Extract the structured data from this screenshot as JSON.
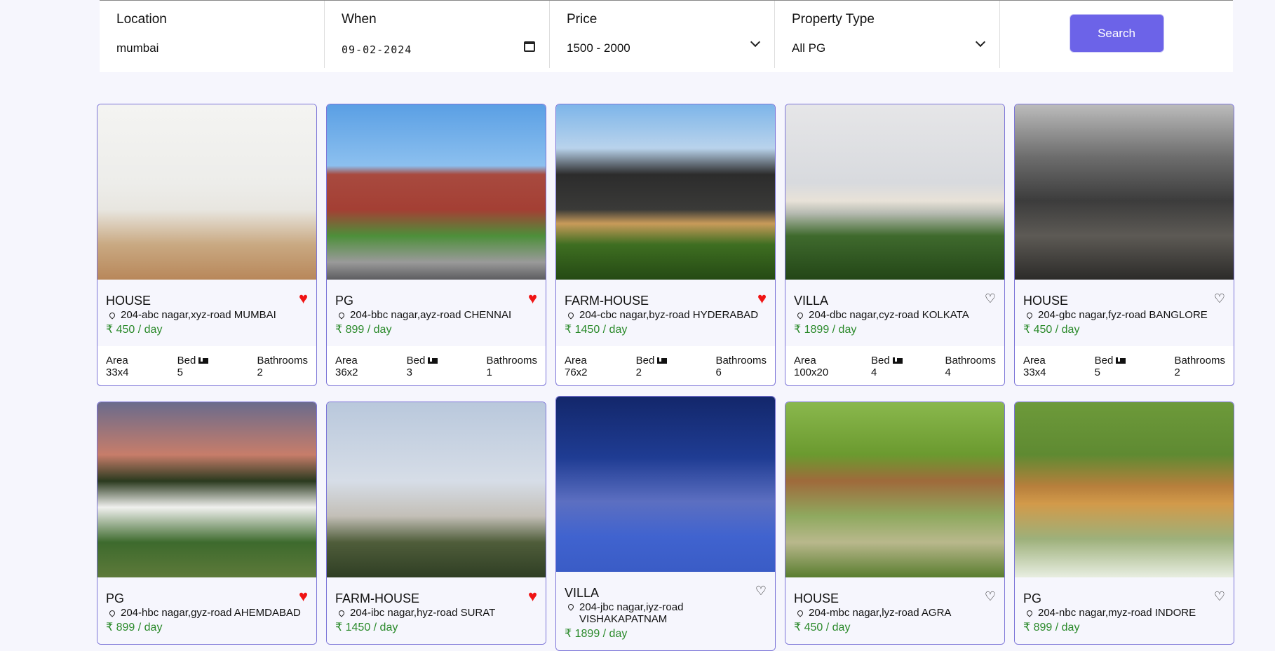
{
  "search": {
    "location_label": "Location",
    "location_value": "mumbai",
    "when_label": "When",
    "when_value": "09-02-2024",
    "price_label": "Price",
    "price_value": "1500 - 2000",
    "type_label": "Property Type",
    "type_value": "All PG",
    "button_label": "Search"
  },
  "stat_labels": {
    "area": "Area",
    "bed": "Bed",
    "bathrooms": "Bathrooms"
  },
  "colors": {
    "accent": "#6c63e8",
    "price": "#2b8a2b",
    "favorite": "#f01414",
    "card_border": "#7c75d8"
  },
  "listings": [
    {
      "type": "HOUSE",
      "address": "204-abc nagar,xyz-road MUMBAI",
      "price": "₹  450 / day",
      "favorite": true,
      "area": "33x4",
      "bed": "5",
      "baths": "2"
    },
    {
      "type": "PG",
      "address": "204-bbc nagar,ayz-road CHENNAI",
      "price": "₹  899 / day",
      "favorite": true,
      "area": "36x2",
      "bed": "3",
      "baths": "1"
    },
    {
      "type": "FARM-HOUSE",
      "address": "204-cbc nagar,byz-road HYDERABAD",
      "price": "₹  1450 / day",
      "favorite": true,
      "area": "76x2",
      "bed": "2",
      "baths": "6"
    },
    {
      "type": "VILLA",
      "address": "204-dbc nagar,cyz-road KOLKATA",
      "price": "₹  1899 / day",
      "favorite": false,
      "area": "100x20",
      "bed": "4",
      "baths": "4"
    },
    {
      "type": "HOUSE",
      "address": "204-gbc nagar,fyz-road BANGLORE",
      "price": "₹  450 / day",
      "favorite": false,
      "area": "33x4",
      "bed": "5",
      "baths": "2"
    },
    {
      "type": "PG",
      "address": "204-hbc nagar,gyz-road AHEMDABAD",
      "price": "₹  899 / day",
      "favorite": true
    },
    {
      "type": "FARM-HOUSE",
      "address": "204-ibc nagar,hyz-road SURAT",
      "price": "₹  1450 / day",
      "favorite": true
    },
    {
      "type": "VILLA",
      "address": "204-jbc nagar,iyz-road VISHAKAPATNAM",
      "price": "₹  1899 / day",
      "favorite": false
    },
    {
      "type": "HOUSE",
      "address": "204-mbc nagar,lyz-road AGRA",
      "price": "₹  450 / day",
      "favorite": false
    },
    {
      "type": "PG",
      "address": "204-nbc nagar,myz-road INDORE",
      "price": "₹  899 / day",
      "favorite": false
    }
  ],
  "icons": {
    "favorite_on": "heart-filled-icon",
    "favorite_off": "heart-outline-icon",
    "location": "map-pin-icon",
    "bed": "bed-icon",
    "calendar": "calendar-icon",
    "dropdown": "chevron-down-icon"
  }
}
